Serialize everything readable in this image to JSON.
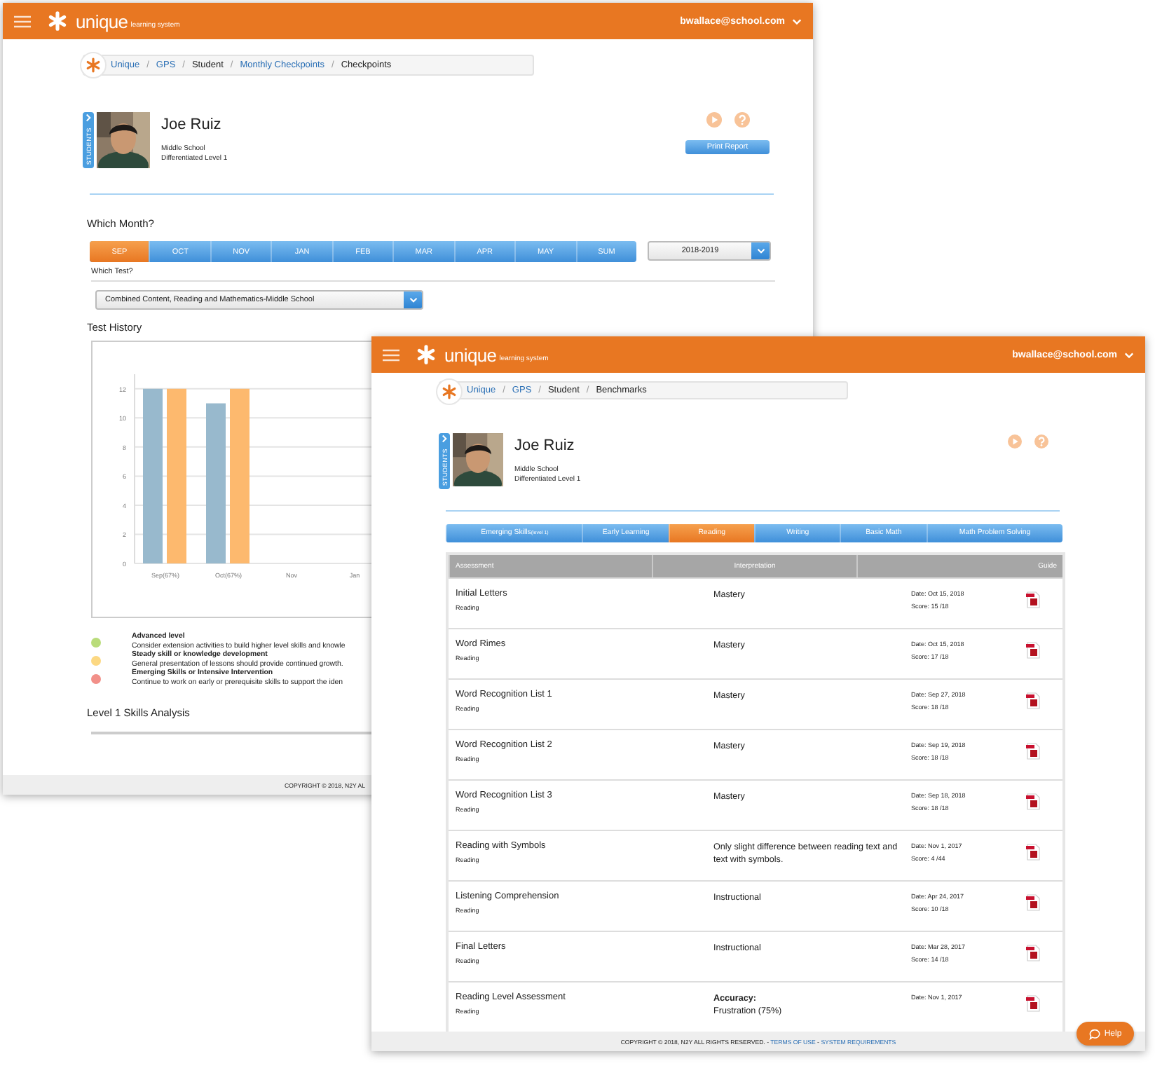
{
  "back_window": {
    "header": {
      "logo": "unique",
      "logo_subtitle": "learning system",
      "user": "bwallace@school.com"
    },
    "breadcrumb": [
      {
        "label": "Unique",
        "link": true
      },
      {
        "label": "GPS",
        "link": true
      },
      {
        "label": "Student",
        "link": false
      },
      {
        "label": "Monthly Checkpoints",
        "link": true
      },
      {
        "label": "Checkpoints",
        "link": false
      }
    ],
    "breadcrumb_separator": "/",
    "students_tab": "STUDENTS",
    "student": {
      "name": "Joe Ruiz",
      "school": "Middle School",
      "level": "Differentiated Level 1"
    },
    "print_button": "Print Report",
    "month_heading": "Which Month?",
    "months": [
      {
        "label": "SEP",
        "selected": true
      },
      {
        "label": "OCT",
        "selected": false
      },
      {
        "label": "NOV",
        "selected": false
      },
      {
        "label": "JAN",
        "selected": false
      },
      {
        "label": "FEB",
        "selected": false
      },
      {
        "label": "MAR",
        "selected": false
      },
      {
        "label": "APR",
        "selected": false
      },
      {
        "label": "MAY",
        "selected": false
      },
      {
        "label": "SUM",
        "selected": false
      }
    ],
    "year": "2018-2019",
    "test_heading": "Which Test?",
    "test": "Combined Content, Reading and Mathematics-Middle School",
    "history_heading": "Test History",
    "chart_data": {
      "type": "bar",
      "categories": [
        "Sep(67%)",
        "Oct(67%)",
        "Nov",
        "Jan"
      ],
      "ylim": [
        0,
        13
      ],
      "grid": true,
      "yticks": [
        0,
        2,
        4,
        6,
        8,
        10,
        12
      ],
      "series": [
        {
          "color": "#98b9cd",
          "values": [
            12,
            11,
            null,
            null
          ]
        },
        {
          "color": "#fdb96e",
          "values": [
            12,
            12,
            null,
            null
          ]
        }
      ]
    },
    "legend": [
      {
        "title": "Advanced level",
        "text": "Consider extension activities to build higher level skills and knowle",
        "color": "#b9dc7a"
      },
      {
        "title": "Steady skill or knowledge development",
        "text": "General presentation of lessons should provide continued growth.",
        "color": "#fcd882"
      },
      {
        "title": "Emerging Skills or Intensive Intervention",
        "text": "Continue to work on early or prerequisite skills to support the iden",
        "color": "#f29089"
      }
    ],
    "analysis_heading": "Level 1 Skills Analysis",
    "footer": "COPYRIGHT © 2018, N2Y AL"
  },
  "front_window": {
    "header": {
      "logo": "unique",
      "logo_subtitle": "learning system",
      "user": "bwallace@school.com"
    },
    "breadcrumb": [
      {
        "label": "Unique",
        "link": true
      },
      {
        "label": "GPS",
        "link": true
      },
      {
        "label": "Student",
        "link": false
      },
      {
        "label": "Benchmarks",
        "link": false
      }
    ],
    "breadcrumb_separator": "/",
    "students_tab": "STUDENTS",
    "student": {
      "name": "Joe Ruiz",
      "school": "Middle School",
      "level": "Differentiated Level 1"
    },
    "tabs": [
      {
        "label": "Emerging Skills",
        "note": "(level 1)",
        "selected": false
      },
      {
        "label": "Early Learning",
        "selected": false
      },
      {
        "label": "Reading",
        "selected": true
      },
      {
        "label": "Writing",
        "selected": false
      },
      {
        "label": "Basic Math",
        "selected": false
      },
      {
        "label": "Math Problem Solving",
        "selected": false
      }
    ],
    "columns": [
      "Assessment",
      "Interpretation",
      "Guide"
    ],
    "rows": [
      {
        "name": "Initial Letters",
        "subject": "Reading",
        "interpretation": [
          "Mastery"
        ],
        "date": "Date: Oct 15, 2018",
        "score": "Score: 15 /18"
      },
      {
        "name": "Word Rimes",
        "subject": "Reading",
        "interpretation": [
          "Mastery"
        ],
        "date": "Date: Oct 15, 2018",
        "score": "Score: 17 /18"
      },
      {
        "name": "Word Recognition List 1",
        "subject": "Reading",
        "interpretation": [
          "Mastery"
        ],
        "date": "Date: Sep 27, 2018",
        "score": "Score: 18 /18"
      },
      {
        "name": "Word Recognition List 2",
        "subject": "Reading",
        "interpretation": [
          "Mastery"
        ],
        "date": "Date: Sep 19, 2018",
        "score": "Score: 18 /18"
      },
      {
        "name": "Word Recognition List 3",
        "subject": "Reading",
        "interpretation": [
          "Mastery"
        ],
        "date": "Date: Sep 18, 2018",
        "score": "Score: 18 /18"
      },
      {
        "name": "Reading with Symbols",
        "subject": "Reading",
        "interpretation": [
          "Only slight difference between reading text and text with symbols."
        ],
        "date": "Date: Nov 1, 2017",
        "score": "Score: 4 /44"
      },
      {
        "name": "Listening Comprehension",
        "subject": "Reading",
        "interpretation": [
          "Instructional"
        ],
        "date": "Date: Apr 24, 2017",
        "score": "Score: 10 /18"
      },
      {
        "name": "Final Letters",
        "subject": "Reading",
        "interpretation": [
          "Instructional"
        ],
        "date": "Date: Mar 28, 2017",
        "score": "Score: 14 /18"
      },
      {
        "name": "Reading Level Assessment",
        "subject": "Reading",
        "interpretation": [
          "**Accuracy:**",
          "Frustration (75%)"
        ],
        "date": "Date: Nov 1, 2017"
      }
    ],
    "footer": {
      "text": "COPYRIGHT © 2018, N2Y ALL RIGHTS RESERVED.",
      "separator": "-",
      "links": [
        "TERMS OF USE",
        "SYSTEM REQUIREMENTS"
      ]
    },
    "help_button": "Help"
  }
}
